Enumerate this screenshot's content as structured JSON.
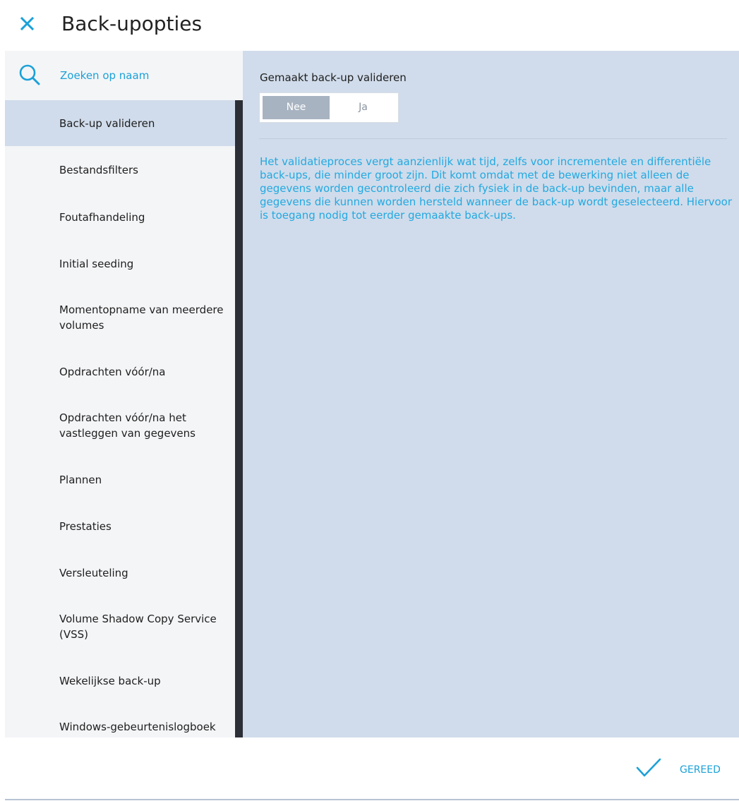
{
  "header": {
    "title": "Back-upopties"
  },
  "sidebar": {
    "search_placeholder": "Zoeken op naam",
    "items": [
      {
        "label": "Back-up valideren",
        "active": true
      },
      {
        "label": "Bestandsfilters",
        "active": false
      },
      {
        "label": "Foutafhandeling",
        "active": false
      },
      {
        "label": "Initial seeding",
        "active": false
      },
      {
        "label": "Momentopname van meerdere volumes",
        "active": false
      },
      {
        "label": "Opdrachten vóór/na",
        "active": false
      },
      {
        "label": "Opdrachten vóór/na het vastleggen van gegevens",
        "active": false
      },
      {
        "label": "Plannen",
        "active": false
      },
      {
        "label": "Prestaties",
        "active": false
      },
      {
        "label": "Versleuteling",
        "active": false
      },
      {
        "label": "Volume Shadow Copy Service (VSS)",
        "active": false
      },
      {
        "label": "Wekelijkse back-up",
        "active": false
      },
      {
        "label": "Windows-gebeurtenislogboek",
        "active": false
      }
    ]
  },
  "main": {
    "setting_label": "Gemaakt back-up valideren",
    "toggle": {
      "no_label": "Nee",
      "yes_label": "Ja",
      "selected": "Nee"
    },
    "description": "Het validatieproces vergt aanzienlijk wat tijd, zelfs voor incrementele en differentiële back-ups, die minder groot zijn. Dit komt omdat met de bewerking niet alleen de gegevens worden gecontroleerd die zich fysiek in de back-up bevinden, maar alle gegevens die kunnen worden hersteld wanneer de back-up wordt geselecteerd. Hiervoor is toegang nodig tot eerder gemaakte back-ups."
  },
  "footer": {
    "done_label": "GEREED"
  },
  "colors": {
    "accent": "#1ba1d8",
    "panel_bg": "#d0dceb",
    "sidebar_bg": "#f4f5f7",
    "scrollbar": "#2d2f36"
  },
  "icons": {
    "close": "close-icon",
    "search": "search-icon",
    "done": "check-icon"
  }
}
